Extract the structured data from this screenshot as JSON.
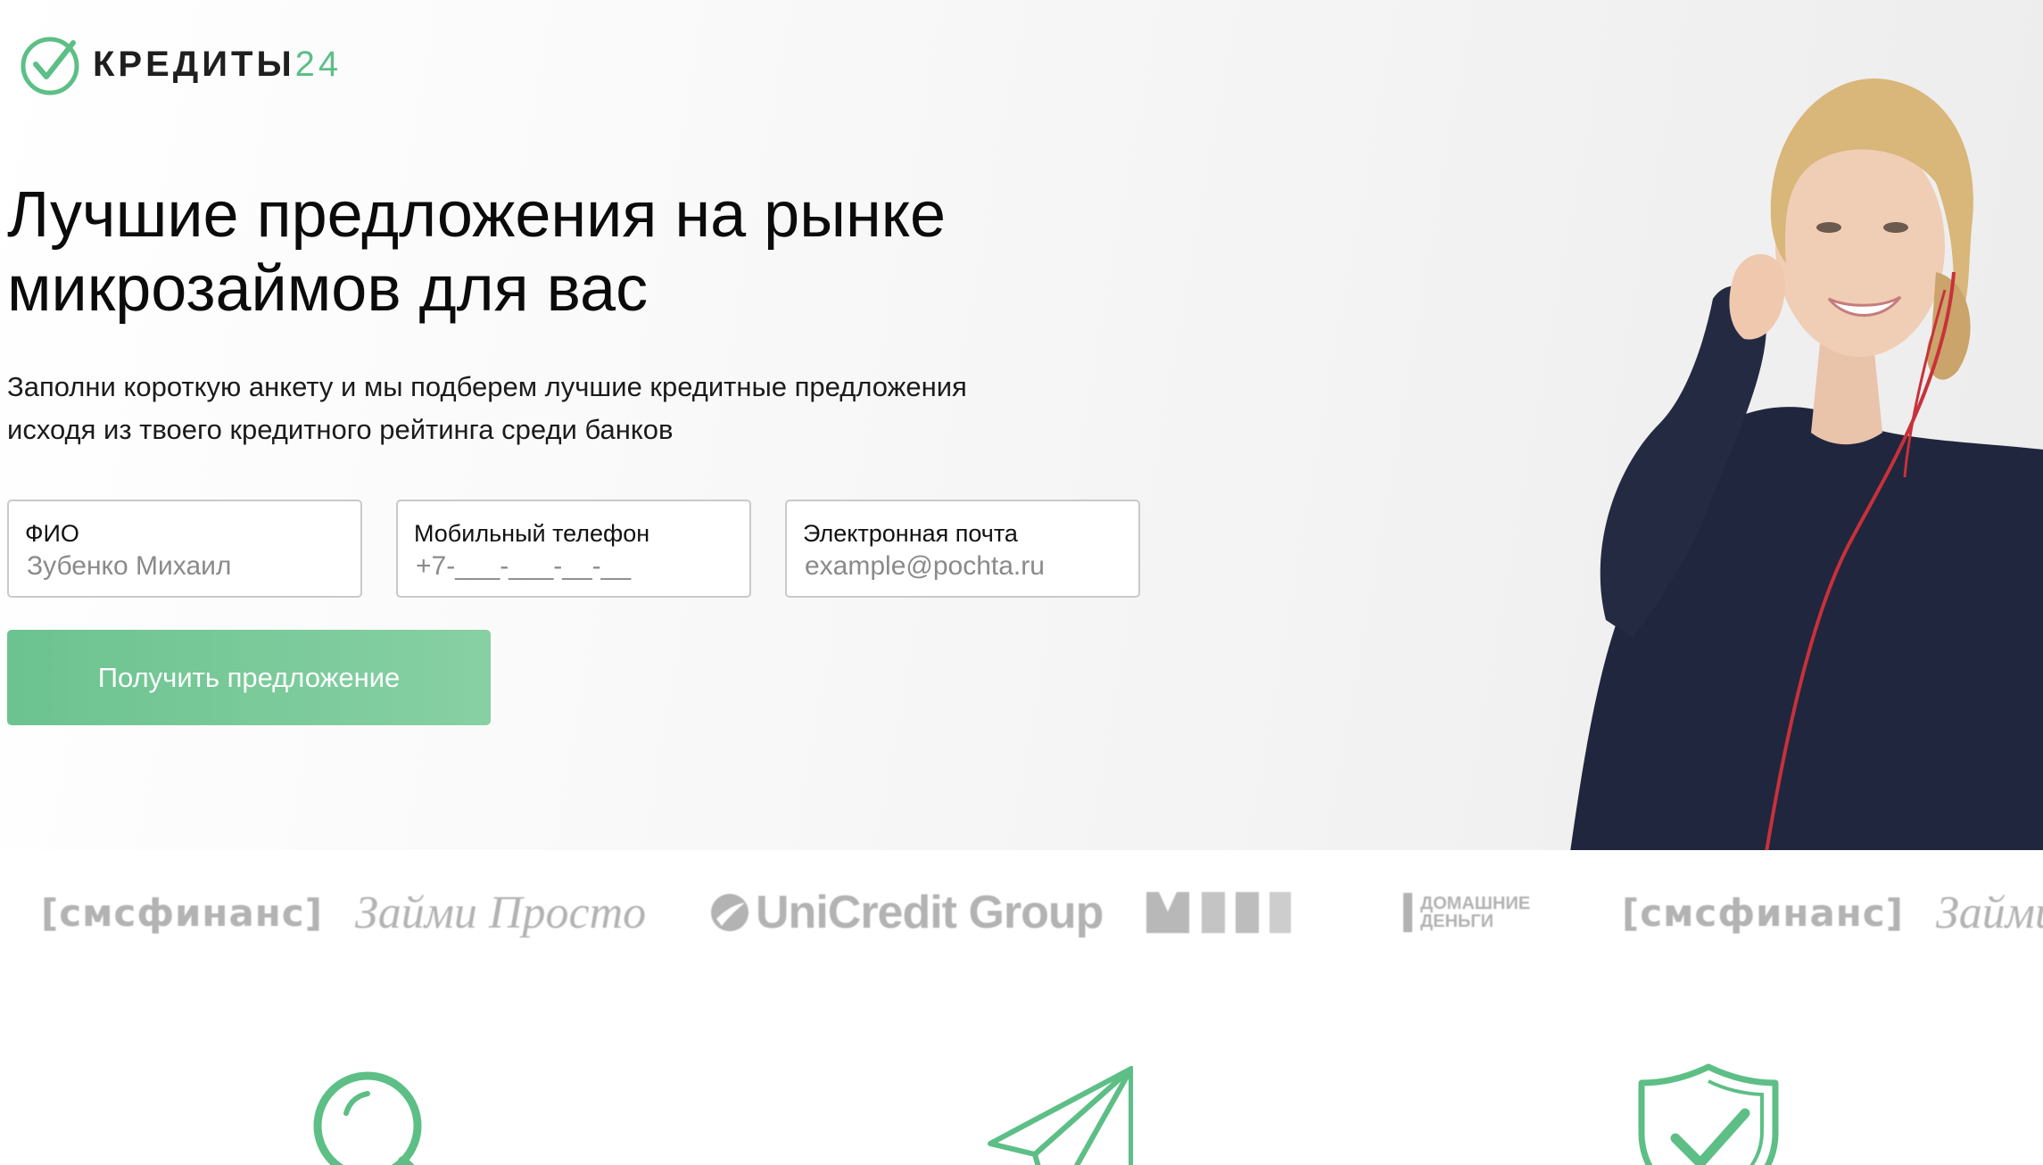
{
  "brand": {
    "name": "КРЕДИТЫ",
    "number": "24",
    "accent_color": "#5dbf86"
  },
  "hero": {
    "headline_line1": "Лучшие предложения на рынке",
    "headline_line2": "микрозаймов для вас",
    "subtitle_line1": "Заполни короткую анкету и мы подберем лучшие кредитные предложения",
    "subtitle_line2": "исходя из твоего кредитного рейтинга среди банков"
  },
  "form": {
    "fields": [
      {
        "label": "ФИО",
        "placeholder": "Зубенко Михаил"
      },
      {
        "label": "Мобильный телефон",
        "placeholder": "+7-___-___-__-__"
      },
      {
        "label": "Электронная почта",
        "placeholder": "example@pochta.ru"
      }
    ],
    "submit_label": "Получить предложение"
  },
  "partners": [
    {
      "name": "[смсфинанс]"
    },
    {
      "name": "Займи Просто"
    },
    {
      "name": "UniCredit Group"
    },
    {
      "name": "MILI",
      "render": "logo"
    },
    {
      "name": "ДОМАШНИЕ ДЕНЬГИ"
    },
    {
      "name": "[смсфинанс]"
    },
    {
      "name": "Займи"
    }
  ],
  "features": [
    {
      "icon": "magnifier-icon"
    },
    {
      "icon": "paper-plane-icon"
    },
    {
      "icon": "shield-check-icon"
    }
  ]
}
